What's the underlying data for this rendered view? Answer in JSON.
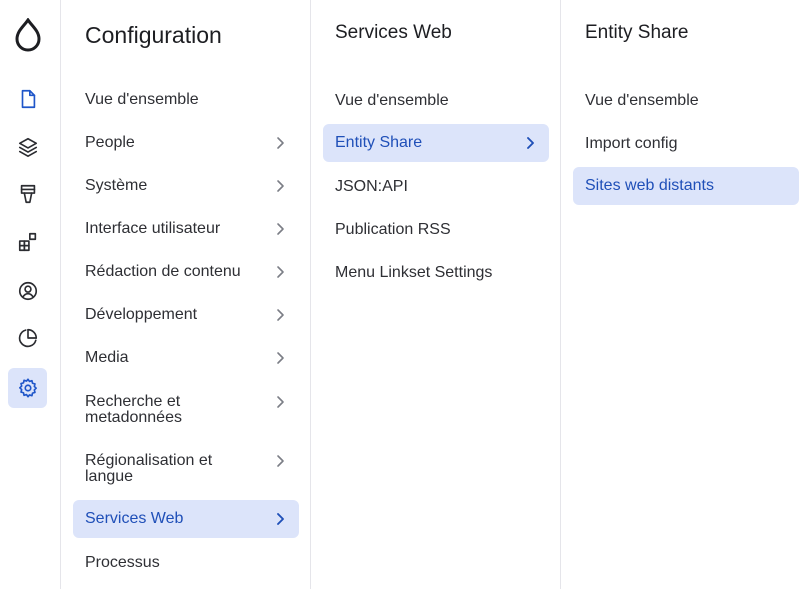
{
  "columns": {
    "configuration": {
      "title": "Configuration",
      "items": [
        {
          "label": "Vue d'ensemble"
        },
        {
          "label": "People"
        },
        {
          "label": "Système"
        },
        {
          "label": "Interface utilisateur"
        },
        {
          "label": "Rédaction de contenu"
        },
        {
          "label": "Développement"
        },
        {
          "label": "Media"
        },
        {
          "label": "Recherche et metadonnées"
        },
        {
          "label": "Régionalisation et langue"
        },
        {
          "label": "Services Web"
        },
        {
          "label": "Processus"
        }
      ]
    },
    "services_web": {
      "title": "Services Web",
      "items": [
        {
          "label": "Vue d'ensemble"
        },
        {
          "label": "Entity Share"
        },
        {
          "label": "JSON:API"
        },
        {
          "label": "Publication RSS"
        },
        {
          "label": "Menu Linkset Settings"
        }
      ]
    },
    "entity_share": {
      "title": "Entity Share",
      "items": [
        {
          "label": "Vue d'ensemble"
        },
        {
          "label": "Import config"
        },
        {
          "label": "Sites web distants"
        }
      ]
    }
  },
  "toolbar": {
    "icons": [
      "drupal-logo",
      "content-icon",
      "structure-icon",
      "appearance-icon",
      "extend-icon",
      "people-icon",
      "reports-icon",
      "configuration-icon"
    ],
    "accent": "#1f56c9",
    "selected_bg": "#dce4fa"
  }
}
